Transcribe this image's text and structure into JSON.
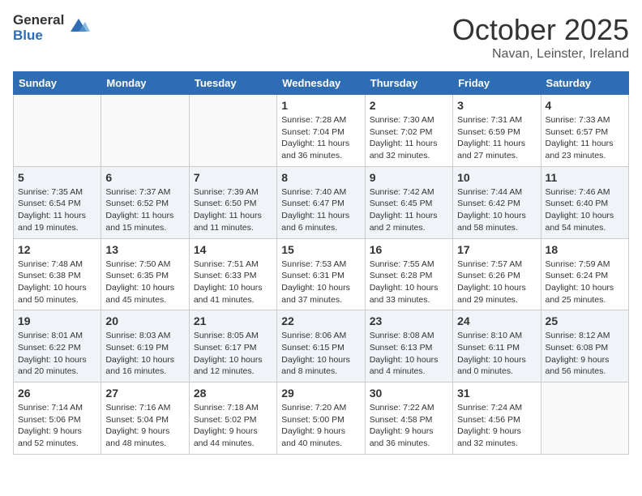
{
  "logo": {
    "general": "General",
    "blue": "Blue"
  },
  "title": "October 2025",
  "location": "Navan, Leinster, Ireland",
  "days_of_week": [
    "Sunday",
    "Monday",
    "Tuesday",
    "Wednesday",
    "Thursday",
    "Friday",
    "Saturday"
  ],
  "weeks": [
    [
      {
        "day": "",
        "info": ""
      },
      {
        "day": "",
        "info": ""
      },
      {
        "day": "",
        "info": ""
      },
      {
        "day": "1",
        "info": "Sunrise: 7:28 AM\nSunset: 7:04 PM\nDaylight: 11 hours\nand 36 minutes."
      },
      {
        "day": "2",
        "info": "Sunrise: 7:30 AM\nSunset: 7:02 PM\nDaylight: 11 hours\nand 32 minutes."
      },
      {
        "day": "3",
        "info": "Sunrise: 7:31 AM\nSunset: 6:59 PM\nDaylight: 11 hours\nand 27 minutes."
      },
      {
        "day": "4",
        "info": "Sunrise: 7:33 AM\nSunset: 6:57 PM\nDaylight: 11 hours\nand 23 minutes."
      }
    ],
    [
      {
        "day": "5",
        "info": "Sunrise: 7:35 AM\nSunset: 6:54 PM\nDaylight: 11 hours\nand 19 minutes."
      },
      {
        "day": "6",
        "info": "Sunrise: 7:37 AM\nSunset: 6:52 PM\nDaylight: 11 hours\nand 15 minutes."
      },
      {
        "day": "7",
        "info": "Sunrise: 7:39 AM\nSunset: 6:50 PM\nDaylight: 11 hours\nand 11 minutes."
      },
      {
        "day": "8",
        "info": "Sunrise: 7:40 AM\nSunset: 6:47 PM\nDaylight: 11 hours\nand 6 minutes."
      },
      {
        "day": "9",
        "info": "Sunrise: 7:42 AM\nSunset: 6:45 PM\nDaylight: 11 hours\nand 2 minutes."
      },
      {
        "day": "10",
        "info": "Sunrise: 7:44 AM\nSunset: 6:42 PM\nDaylight: 10 hours\nand 58 minutes."
      },
      {
        "day": "11",
        "info": "Sunrise: 7:46 AM\nSunset: 6:40 PM\nDaylight: 10 hours\nand 54 minutes."
      }
    ],
    [
      {
        "day": "12",
        "info": "Sunrise: 7:48 AM\nSunset: 6:38 PM\nDaylight: 10 hours\nand 50 minutes."
      },
      {
        "day": "13",
        "info": "Sunrise: 7:50 AM\nSunset: 6:35 PM\nDaylight: 10 hours\nand 45 minutes."
      },
      {
        "day": "14",
        "info": "Sunrise: 7:51 AM\nSunset: 6:33 PM\nDaylight: 10 hours\nand 41 minutes."
      },
      {
        "day": "15",
        "info": "Sunrise: 7:53 AM\nSunset: 6:31 PM\nDaylight: 10 hours\nand 37 minutes."
      },
      {
        "day": "16",
        "info": "Sunrise: 7:55 AM\nSunset: 6:28 PM\nDaylight: 10 hours\nand 33 minutes."
      },
      {
        "day": "17",
        "info": "Sunrise: 7:57 AM\nSunset: 6:26 PM\nDaylight: 10 hours\nand 29 minutes."
      },
      {
        "day": "18",
        "info": "Sunrise: 7:59 AM\nSunset: 6:24 PM\nDaylight: 10 hours\nand 25 minutes."
      }
    ],
    [
      {
        "day": "19",
        "info": "Sunrise: 8:01 AM\nSunset: 6:22 PM\nDaylight: 10 hours\nand 20 minutes."
      },
      {
        "day": "20",
        "info": "Sunrise: 8:03 AM\nSunset: 6:19 PM\nDaylight: 10 hours\nand 16 minutes."
      },
      {
        "day": "21",
        "info": "Sunrise: 8:05 AM\nSunset: 6:17 PM\nDaylight: 10 hours\nand 12 minutes."
      },
      {
        "day": "22",
        "info": "Sunrise: 8:06 AM\nSunset: 6:15 PM\nDaylight: 10 hours\nand 8 minutes."
      },
      {
        "day": "23",
        "info": "Sunrise: 8:08 AM\nSunset: 6:13 PM\nDaylight: 10 hours\nand 4 minutes."
      },
      {
        "day": "24",
        "info": "Sunrise: 8:10 AM\nSunset: 6:11 PM\nDaylight: 10 hours\nand 0 minutes."
      },
      {
        "day": "25",
        "info": "Sunrise: 8:12 AM\nSunset: 6:08 PM\nDaylight: 9 hours\nand 56 minutes."
      }
    ],
    [
      {
        "day": "26",
        "info": "Sunrise: 7:14 AM\nSunset: 5:06 PM\nDaylight: 9 hours\nand 52 minutes."
      },
      {
        "day": "27",
        "info": "Sunrise: 7:16 AM\nSunset: 5:04 PM\nDaylight: 9 hours\nand 48 minutes."
      },
      {
        "day": "28",
        "info": "Sunrise: 7:18 AM\nSunset: 5:02 PM\nDaylight: 9 hours\nand 44 minutes."
      },
      {
        "day": "29",
        "info": "Sunrise: 7:20 AM\nSunset: 5:00 PM\nDaylight: 9 hours\nand 40 minutes."
      },
      {
        "day": "30",
        "info": "Sunrise: 7:22 AM\nSunset: 4:58 PM\nDaylight: 9 hours\nand 36 minutes."
      },
      {
        "day": "31",
        "info": "Sunrise: 7:24 AM\nSunset: 4:56 PM\nDaylight: 9 hours\nand 32 minutes."
      },
      {
        "day": "",
        "info": ""
      }
    ]
  ]
}
